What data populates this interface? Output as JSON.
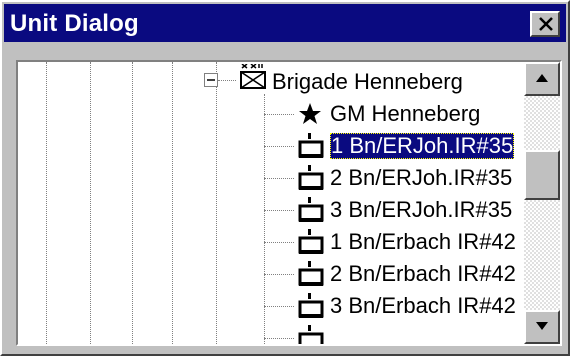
{
  "window": {
    "title": "Unit Dialog"
  },
  "tree": {
    "parent": {
      "label": "Brigade Henneberg",
      "icon": "brigade-icon",
      "expanded": true
    },
    "items": [
      {
        "label": "GM Henneberg",
        "icon": "star-icon",
        "selected": false
      },
      {
        "label": "1 Bn/ERJoh.IR#35",
        "icon": "battalion-icon",
        "selected": true
      },
      {
        "label": "2 Bn/ERJoh.IR#35",
        "icon": "battalion-icon",
        "selected": false
      },
      {
        "label": "3 Bn/ERJoh.IR#35",
        "icon": "battalion-icon",
        "selected": false
      },
      {
        "label": "1 Bn/Erbach IR#42",
        "icon": "battalion-icon",
        "selected": false
      },
      {
        "label": "2 Bn/Erbach IR#42",
        "icon": "battalion-icon",
        "selected": false
      },
      {
        "label": "3 Bn/Erbach IR#42",
        "icon": "battalion-icon",
        "selected": false
      }
    ]
  },
  "colors": {
    "titlebar": "#0a0a80",
    "selection": "#0a0a80",
    "face": "#c0c0c0"
  }
}
